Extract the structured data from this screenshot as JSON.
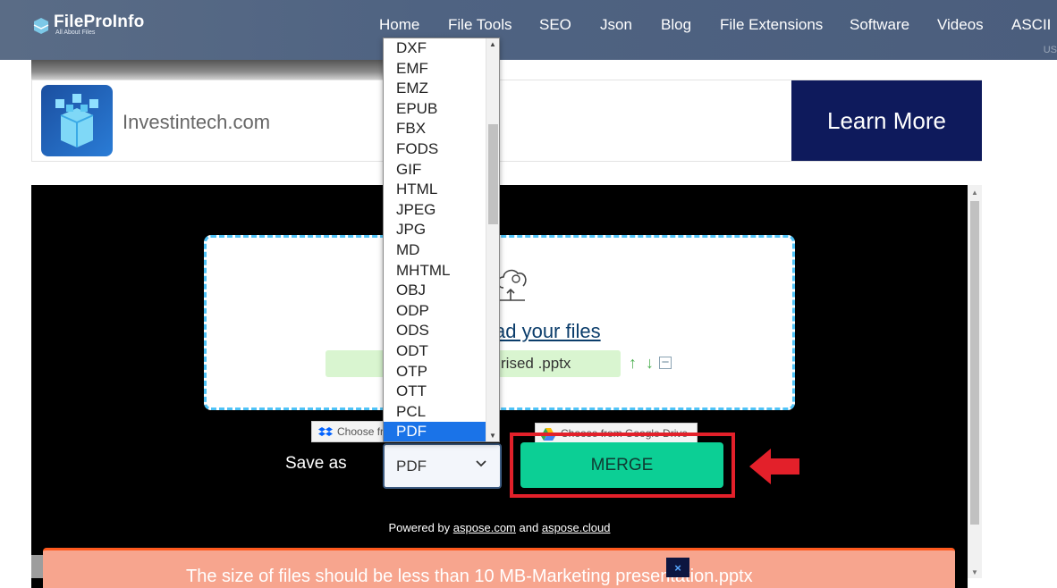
{
  "header": {
    "logo_title": "FileProInfo",
    "logo_subtitle": "All About Files",
    "nav": [
      "Home",
      "File Tools",
      "SEO",
      "Json",
      "Blog",
      "File Extensions",
      "Software",
      "Videos",
      "ASCII"
    ],
    "extra_text": "US"
  },
  "ad": {
    "text": "Investintech.com",
    "cta": "Learn More"
  },
  "tool": {
    "upload_text": "ad your files",
    "file_name": "rised .pptx",
    "dropbox_label": "Choose fr",
    "gdrive_label": "Choose from Google Drive",
    "save_as_label": "Save as",
    "selected_format": "PDF",
    "merge_label": "MERGE",
    "powered_prefix": "Powered by",
    "powered_link1": "aspose.com",
    "powered_and": "and",
    "powered_link2": "aspose.cloud",
    "warning_text": "The size of files should be less than 10 MB-Marketing presentation.pptx",
    "close_label": "×"
  },
  "dropdown": {
    "options": [
      "DXF",
      "EMF",
      "EMZ",
      "EPUB",
      "FBX",
      "FODS",
      "GIF",
      "HTML",
      "JPEG",
      "JPG",
      "MD",
      "MHTML",
      "OBJ",
      "ODP",
      "ODS",
      "ODT",
      "OTP",
      "OTT",
      "PCL",
      "PDF"
    ],
    "selected": "PDF"
  },
  "colors": {
    "header_bg": "#4f6382",
    "merge_green": "#0ccf95",
    "highlight_red": "#e3202a",
    "warning_bg": "#f7a58e",
    "selected_blue": "#1a73e8",
    "ad_cta_bg": "#0e1a5c"
  },
  "icons": {
    "upload": "cloud-upload-icon",
    "arrow_up": "arrow-up-icon",
    "arrow_down": "arrow-down-icon",
    "remove": "minus-box-icon",
    "dropbox": "dropbox-icon",
    "gdrive": "google-drive-icon",
    "chevron": "chevron-down-icon",
    "pointer": "red-arrow-icon"
  }
}
